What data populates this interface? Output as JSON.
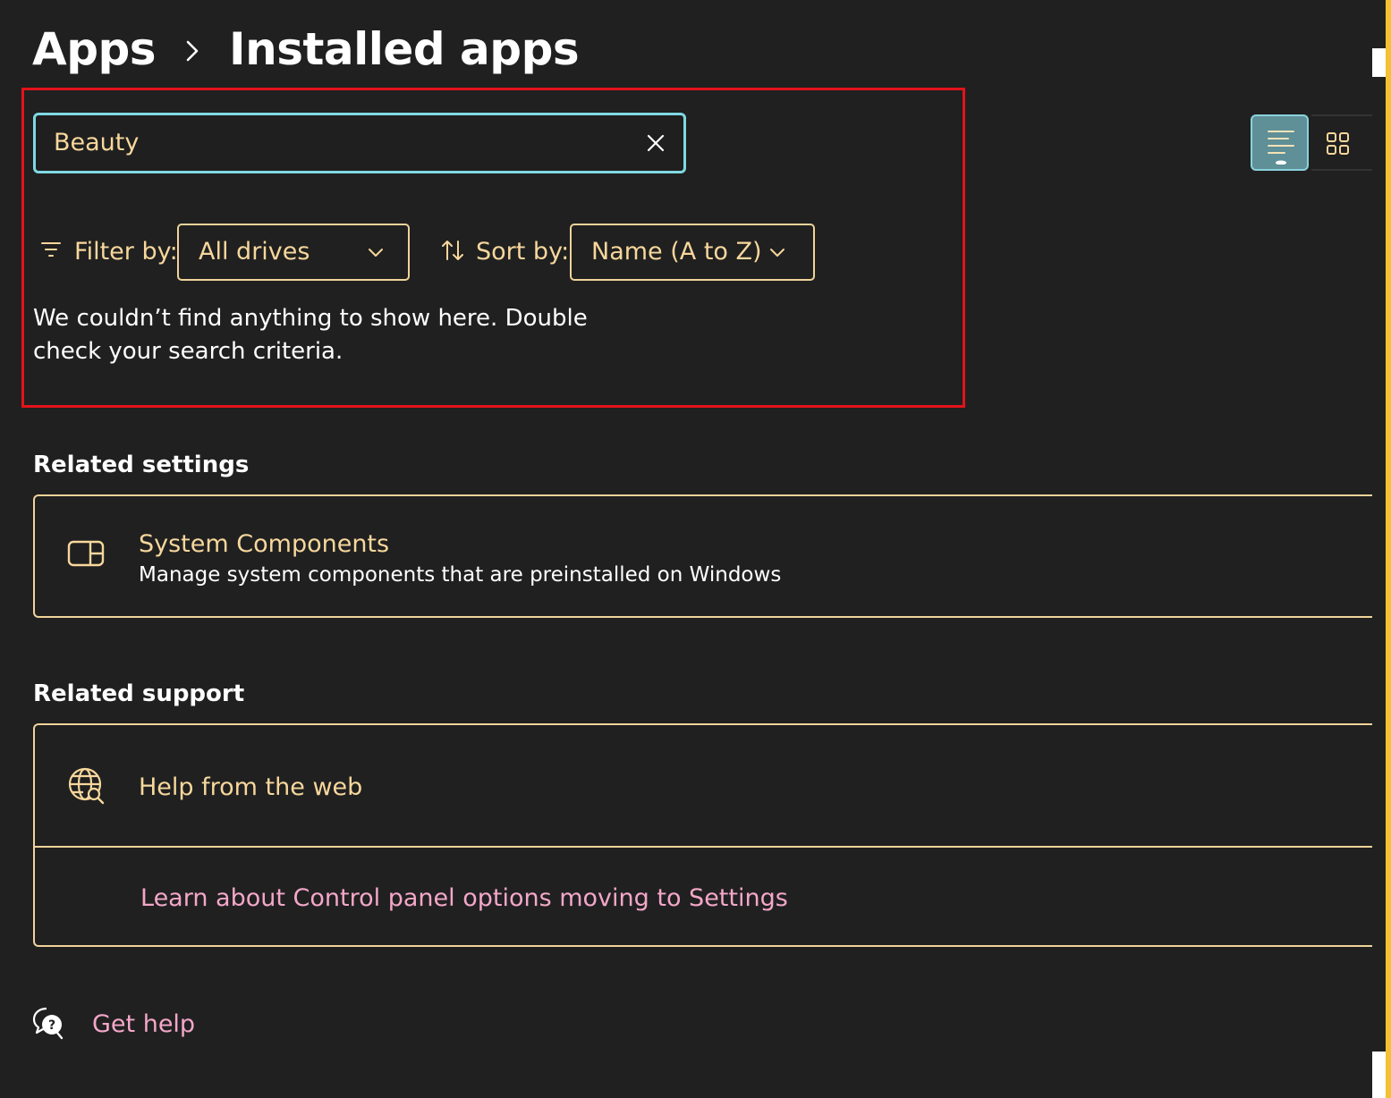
{
  "breadcrumb": {
    "parent": "Apps",
    "current": "Installed apps"
  },
  "search": {
    "value": "Beauty",
    "clear_icon": "close-icon"
  },
  "filter": {
    "label": "Filter by:",
    "selected": "All drives",
    "icon": "filter-icon"
  },
  "sort": {
    "label": "Sort by:",
    "selected": "Name (A to Z)",
    "icon": "sort-icon"
  },
  "empty_message": "We couldn’t find anything to show here. Double check your search criteria.",
  "view_toggle": {
    "list_icon": "list-view-icon",
    "grid_icon": "grid-view-icon",
    "active": "list"
  },
  "related_settings": {
    "title": "Related settings",
    "items": [
      {
        "title": "System Components",
        "description": "Manage system components that are preinstalled on Windows",
        "icon": "system-components-icon"
      }
    ]
  },
  "related_support": {
    "title": "Related support",
    "help_title": "Help from the web",
    "help_icon": "globe-search-icon",
    "link": "Learn about Control panel options moving to Settings"
  },
  "get_help": {
    "label": "Get help",
    "icon": "help-chat-icon"
  },
  "colors": {
    "background": "#202020",
    "accent_text": "#f7d79c",
    "focus_border": "#7fd8e2",
    "link_pink": "#f4a7c8",
    "highlight_red": "#e3131b"
  }
}
